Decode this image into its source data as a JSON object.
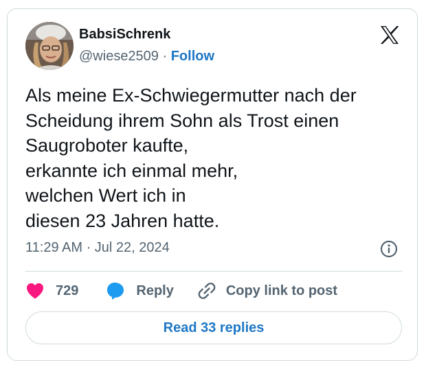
{
  "author": {
    "display_name": "BabsiSchrenk",
    "handle": "@wiese2509",
    "separator": "·",
    "follow_label": "Follow"
  },
  "tweet": {
    "lines": [
      "Als meine Ex-Schwiegermutter nach der",
      "Scheidung ihrem Sohn als Trost einen",
      "Saugroboter kaufte,",
      "erkannte ich einmal mehr,",
      "welchen Wert ich in",
      "diesen 23 Jahren hatte."
    ],
    "timestamp": "11:29 AM · Jul 22, 2024"
  },
  "actions": {
    "like_count": "729",
    "reply_label": "Reply",
    "copy_link_label": "Copy link to post"
  },
  "footer": {
    "read_replies_label": "Read 33 replies"
  },
  "icons": {
    "logo": "x-logo-icon",
    "info": "info-icon",
    "like": "heart-icon",
    "reply": "speech-bubble-icon",
    "copy_link": "link-icon"
  },
  "colors": {
    "accent": "#1d77c6",
    "heart": "#f91880",
    "reply_bubble": "#1d9bf0",
    "muted_text": "#536471",
    "border": "#cfd9de"
  }
}
